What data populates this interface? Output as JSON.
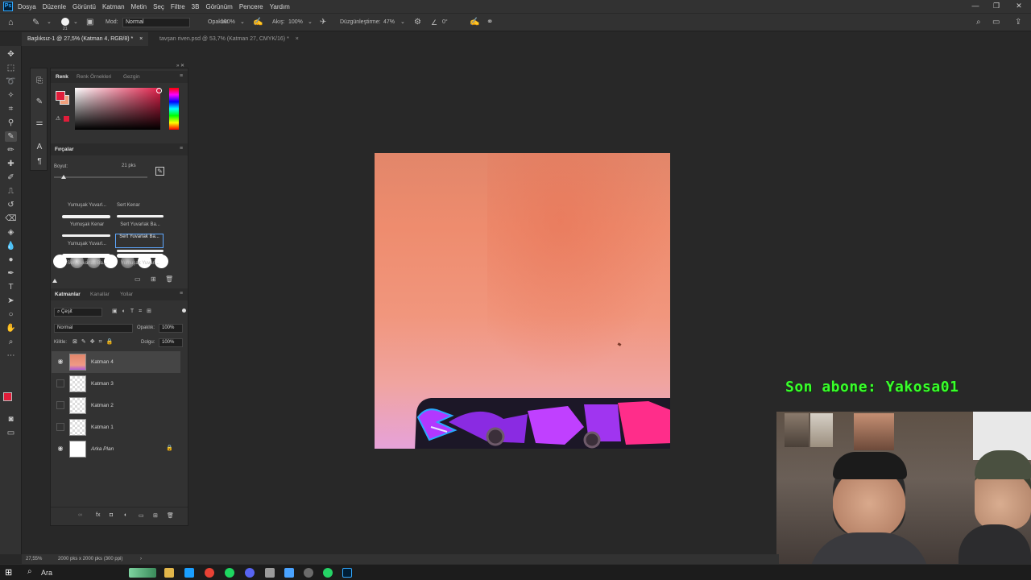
{
  "menubar": {
    "items": [
      "Dosya",
      "Düzenle",
      "Görüntü",
      "Katman",
      "Metin",
      "Seç",
      "Filtre",
      "3B",
      "Görünüm",
      "Pencere",
      "Yardım"
    ]
  },
  "options": {
    "brush_size": "21",
    "mode_label": "Mod:",
    "mode_value": "Normal",
    "opacity_label": "Opaklık:",
    "opacity_value": "100%",
    "flow_label": "Akış:",
    "flow_value": "100%",
    "smoothing_label": "Düzgünleştirme:",
    "smoothing_value": "47%",
    "angle_value": "0°"
  },
  "tabs": [
    {
      "label": "Başlıksız-1 @ 27,5% (Katman 4, RGB/8) *",
      "close": "×"
    },
    {
      "label": "tavşan riven.psd @ 53,7% (Katman 27, CMYK/16) *",
      "close": "×"
    }
  ],
  "color_panel": {
    "tabs": [
      "Renk",
      "Renk Örnekleri",
      "Gezgin"
    ],
    "foreground": "#e01d3a"
  },
  "brushes": {
    "title": "Fırçalar",
    "size_label": "Boyut:",
    "size_value": "21 pks",
    "presets": [
      "Yumuşak Yuvarl...",
      "Sert Kenar",
      "Yumuşak Kenar",
      "Sert Yuvarlak Ba...",
      "Yumuşak Yuvarl...",
      "Sert Yuvarlak Ba...",
      "Sert Yuvarlak Ba...",
      "Yumuşak Yuvarl..."
    ]
  },
  "layers": {
    "tabs": [
      "Katmanlar",
      "Kanallar",
      "Yollar"
    ],
    "filter_label": "Çeşit",
    "blend_mode": "Normal",
    "opacity_label": "Opaklık:",
    "opacity_value": "100%",
    "lock_label": "Kilitle:",
    "fill_label": "Dolgu:",
    "fill_value": "100%",
    "items": [
      {
        "name": "Katman 4",
        "visible": true,
        "selected": true
      },
      {
        "name": "Katman 3",
        "visible": false,
        "selected": false
      },
      {
        "name": "Katman 2",
        "visible": false,
        "selected": false
      },
      {
        "name": "Katman 1",
        "visible": false,
        "selected": false
      },
      {
        "name": "Arka Plan",
        "visible": true,
        "selected": false,
        "locked": true
      }
    ]
  },
  "status": {
    "zoom": "27,55%",
    "doc_info": "2000 pks x 2000 pks (300 ppi)"
  },
  "overlay": {
    "subscriber_text": "Son abone: Yakosa01"
  },
  "taskbar": {
    "search_placeholder": "Ara"
  },
  "colors": {
    "accent": "#31a8ff",
    "overlay_text": "#39ff2b"
  }
}
